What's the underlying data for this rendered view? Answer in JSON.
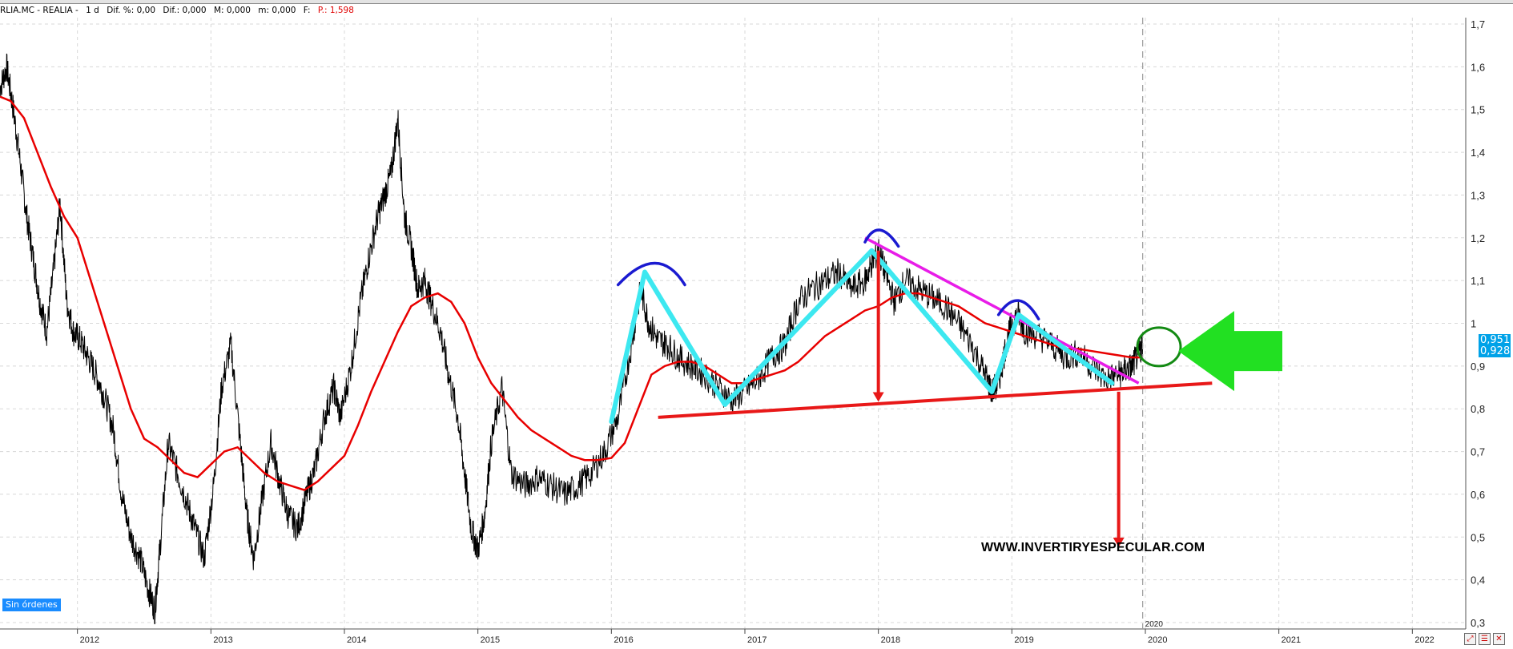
{
  "info_bar": {
    "symbol": "RLIA.MC - REALIA -",
    "period": "1 d",
    "dif_pct": "Dif. %: 0,00",
    "dif": "Dif.: 0,000",
    "max": "M: 0,000",
    "min": "m: 0,000",
    "close": "F:",
    "price": "P.: 1,598"
  },
  "status_badge": "Sin órdenes",
  "watermark": "WWW.INVERTIRYESPECULAR.COM",
  "price_boxes": [
    "0,951",
    "0,928"
  ],
  "colors": {
    "price_line": "#000000",
    "moving_average": "#e80000",
    "cyan_pattern": "#3de8f0",
    "blue_heads": "#1a1ad0",
    "magenta_trendline": "#e81ce8",
    "support_line": "#e81818",
    "target_arrow": "#e81818",
    "green_arrow": "#22e022",
    "green_circle": "#138a13",
    "price_box": "#00a2e8"
  },
  "icons": [
    "zoom-icon",
    "settings-icon",
    "close-icon"
  ],
  "chart_data": {
    "type": "line",
    "title": "",
    "xlabel": "",
    "ylabel": "",
    "x_ticks": [
      "2012",
      "2013",
      "2014",
      "2015",
      "2016",
      "2017",
      "2018",
      "2019",
      "2020",
      "2021",
      "2022"
    ],
    "x_tick_years": [
      2012,
      2013,
      2014,
      2015,
      2016,
      2017,
      2018,
      2019,
      2020,
      2021,
      2022
    ],
    "cursor_label": "2020",
    "y_ticks": [
      "0,3",
      "0,4",
      "0,5",
      "0,6",
      "0,7",
      "0,8",
      "0,9",
      "1",
      "1,1",
      "1,2",
      "1,3",
      "1,4",
      "1,5",
      "1,6",
      "1,7"
    ],
    "y_tick_values": [
      0.3,
      0.4,
      0.5,
      0.6,
      0.7,
      0.8,
      0.9,
      1.0,
      1.1,
      1.2,
      1.3,
      1.4,
      1.5,
      1.6,
      1.7
    ],
    "xlim": [
      2011.42,
      2022.4
    ],
    "ylim": [
      0.285,
      1.715
    ],
    "grid": true,
    "series": [
      {
        "key": "price",
        "x": [
          2011.42,
          2011.47,
          2011.52,
          2011.57,
          2011.62,
          2011.67,
          2011.72,
          2011.77,
          2011.82,
          2011.87,
          2011.92,
          2011.97,
          2012.02,
          2012.08,
          2012.14,
          2012.2,
          2012.27,
          2012.33,
          2012.4,
          2012.47,
          2012.53,
          2012.58,
          2012.62,
          2012.68,
          2012.75,
          2012.82,
          2012.88,
          2012.95,
          2013.02,
          2013.08,
          2013.15,
          2013.22,
          2013.27,
          2013.32,
          2013.38,
          2013.45,
          2013.52,
          2013.58,
          2013.65,
          2013.72,
          2013.78,
          2013.85,
          2013.92,
          2013.97,
          2014.05,
          2014.12,
          2014.18,
          2014.25,
          2014.3,
          2014.35,
          2014.4,
          2014.45,
          2014.5,
          2014.55,
          2014.6,
          2014.65,
          2014.72,
          2014.78,
          2014.85,
          2014.9,
          2014.95,
          2015.0,
          2015.05,
          2015.1,
          2015.18,
          2015.25,
          2015.35,
          2015.45,
          2015.55,
          2015.65,
          2015.75,
          2015.85,
          2015.95,
          2016.05,
          2016.15,
          2016.22,
          2016.28,
          2016.35,
          2016.42,
          2016.5,
          2016.6,
          2016.7,
          2016.8,
          2016.9,
          2017.0,
          2017.1,
          2017.2,
          2017.3,
          2017.4,
          2017.5,
          2017.6,
          2017.7,
          2017.8,
          2017.9,
          2017.95,
          2018.0,
          2018.05,
          2018.12,
          2018.2,
          2018.3,
          2018.4,
          2018.5,
          2018.6,
          2018.7,
          2018.8,
          2018.85,
          2018.9,
          2018.95,
          2019.0,
          2019.05,
          2019.1,
          2019.2,
          2019.3,
          2019.4,
          2019.5,
          2019.6,
          2019.7,
          2019.8,
          2019.85,
          2019.9,
          2019.95,
          2019.98
        ],
        "y": [
          1.55,
          1.6,
          1.5,
          1.38,
          1.25,
          1.15,
          1.05,
          0.98,
          1.12,
          1.28,
          1.05,
          0.98,
          0.96,
          0.92,
          0.88,
          0.83,
          0.75,
          0.6,
          0.5,
          0.45,
          0.38,
          0.33,
          0.48,
          0.72,
          0.65,
          0.58,
          0.52,
          0.45,
          0.62,
          0.85,
          0.95,
          0.72,
          0.55,
          0.45,
          0.58,
          0.72,
          0.62,
          0.55,
          0.52,
          0.6,
          0.66,
          0.78,
          0.85,
          0.78,
          0.9,
          1.05,
          1.15,
          1.25,
          1.3,
          1.35,
          1.48,
          1.25,
          1.18,
          1.08,
          1.1,
          1.05,
          0.98,
          0.88,
          0.78,
          0.65,
          0.52,
          0.47,
          0.55,
          0.72,
          0.85,
          0.65,
          0.62,
          0.64,
          0.62,
          0.6,
          0.62,
          0.65,
          0.7,
          0.78,
          0.95,
          1.08,
          1.0,
          0.96,
          0.95,
          0.92,
          0.9,
          0.88,
          0.85,
          0.82,
          0.84,
          0.87,
          0.92,
          0.95,
          1.05,
          1.08,
          1.1,
          1.12,
          1.08,
          1.1,
          1.14,
          1.17,
          1.12,
          1.05,
          1.1,
          1.08,
          1.06,
          1.04,
          1.0,
          0.95,
          0.88,
          0.84,
          0.86,
          0.94,
          1.0,
          1.02,
          0.98,
          0.97,
          0.95,
          0.92,
          0.93,
          0.9,
          0.87,
          0.88,
          0.89,
          0.9,
          0.93,
          0.95
        ]
      },
      {
        "key": "moving_average",
        "x": [
          2011.42,
          2011.5,
          2011.6,
          2011.7,
          2011.8,
          2011.9,
          2012.0,
          2012.1,
          2012.2,
          2012.3,
          2012.4,
          2012.5,
          2012.6,
          2012.7,
          2012.8,
          2012.9,
          2013.0,
          2013.1,
          2013.2,
          2013.3,
          2013.4,
          2013.5,
          2013.6,
          2013.7,
          2013.8,
          2013.9,
          2014.0,
          2014.1,
          2014.2,
          2014.3,
          2014.4,
          2014.5,
          2014.6,
          2014.7,
          2014.8,
          2014.9,
          2015.0,
          2015.1,
          2015.2,
          2015.3,
          2015.4,
          2015.5,
          2015.6,
          2015.7,
          2015.8,
          2015.9,
          2016.0,
          2016.1,
          2016.2,
          2016.3,
          2016.4,
          2016.5,
          2016.6,
          2016.7,
          2016.8,
          2016.9,
          2017.0,
          2017.1,
          2017.2,
          2017.3,
          2017.4,
          2017.5,
          2017.6,
          2017.7,
          2017.8,
          2017.9,
          2018.0,
          2018.1,
          2018.2,
          2018.3,
          2018.4,
          2018.5,
          2018.6,
          2018.7,
          2018.8,
          2018.9,
          2019.0,
          2019.1,
          2019.2,
          2019.3,
          2019.4,
          2019.5,
          2019.6,
          2019.7,
          2019.8,
          2019.9,
          2019.98
        ],
        "y": [
          1.53,
          1.52,
          1.48,
          1.4,
          1.32,
          1.25,
          1.2,
          1.1,
          1.0,
          0.9,
          0.8,
          0.73,
          0.71,
          0.68,
          0.65,
          0.64,
          0.67,
          0.7,
          0.71,
          0.68,
          0.65,
          0.63,
          0.62,
          0.61,
          0.63,
          0.66,
          0.69,
          0.76,
          0.84,
          0.91,
          0.98,
          1.04,
          1.06,
          1.07,
          1.05,
          1.0,
          0.92,
          0.86,
          0.82,
          0.78,
          0.75,
          0.73,
          0.71,
          0.69,
          0.68,
          0.68,
          0.685,
          0.72,
          0.8,
          0.88,
          0.9,
          0.91,
          0.91,
          0.9,
          0.88,
          0.86,
          0.86,
          0.87,
          0.88,
          0.89,
          0.91,
          0.94,
          0.97,
          0.99,
          1.01,
          1.03,
          1.04,
          1.06,
          1.07,
          1.07,
          1.06,
          1.05,
          1.04,
          1.02,
          1.0,
          0.99,
          0.98,
          0.97,
          0.96,
          0.95,
          0.94,
          0.94,
          0.935,
          0.93,
          0.925,
          0.92,
          0.92
        ]
      }
    ],
    "annotations": {
      "cyan_zigzag": [
        [
          2016.0,
          0.77
        ],
        [
          2016.25,
          1.12
        ],
        [
          2016.85,
          0.81
        ],
        [
          2017.95,
          1.17
        ],
        [
          2018.85,
          0.84
        ],
        [
          2019.05,
          1.02
        ],
        [
          2019.75,
          0.86
        ]
      ],
      "blue_heads": [
        [
          2016.05,
          1.09,
          2016.35,
          1.15,
          2016.55,
          1.09
        ],
        [
          2017.9,
          1.19,
          2018.0,
          1.21,
          2018.15,
          1.18
        ],
        [
          2018.9,
          1.02,
          2019.05,
          1.05,
          2019.2,
          1.01
        ]
      ],
      "magenta_trendline": [
        [
          2017.9,
          1.2
        ],
        [
          2019.95,
          0.86
        ]
      ],
      "support_line": [
        [
          2016.35,
          0.78
        ],
        [
          2020.5,
          0.86
        ]
      ],
      "neckline_arrow": [
        [
          2018.0,
          1.17
        ],
        [
          2018.0,
          0.82
        ]
      ],
      "target_arrow": [
        [
          2019.8,
          0.84
        ],
        [
          2019.8,
          0.48
        ]
      ],
      "green_circle_center": [
        2020.15,
        0.945
      ],
      "green_arrow_tip": [
        2020.15,
        0.935
      ],
      "dashed_cursor_x": 2019.98
    }
  }
}
